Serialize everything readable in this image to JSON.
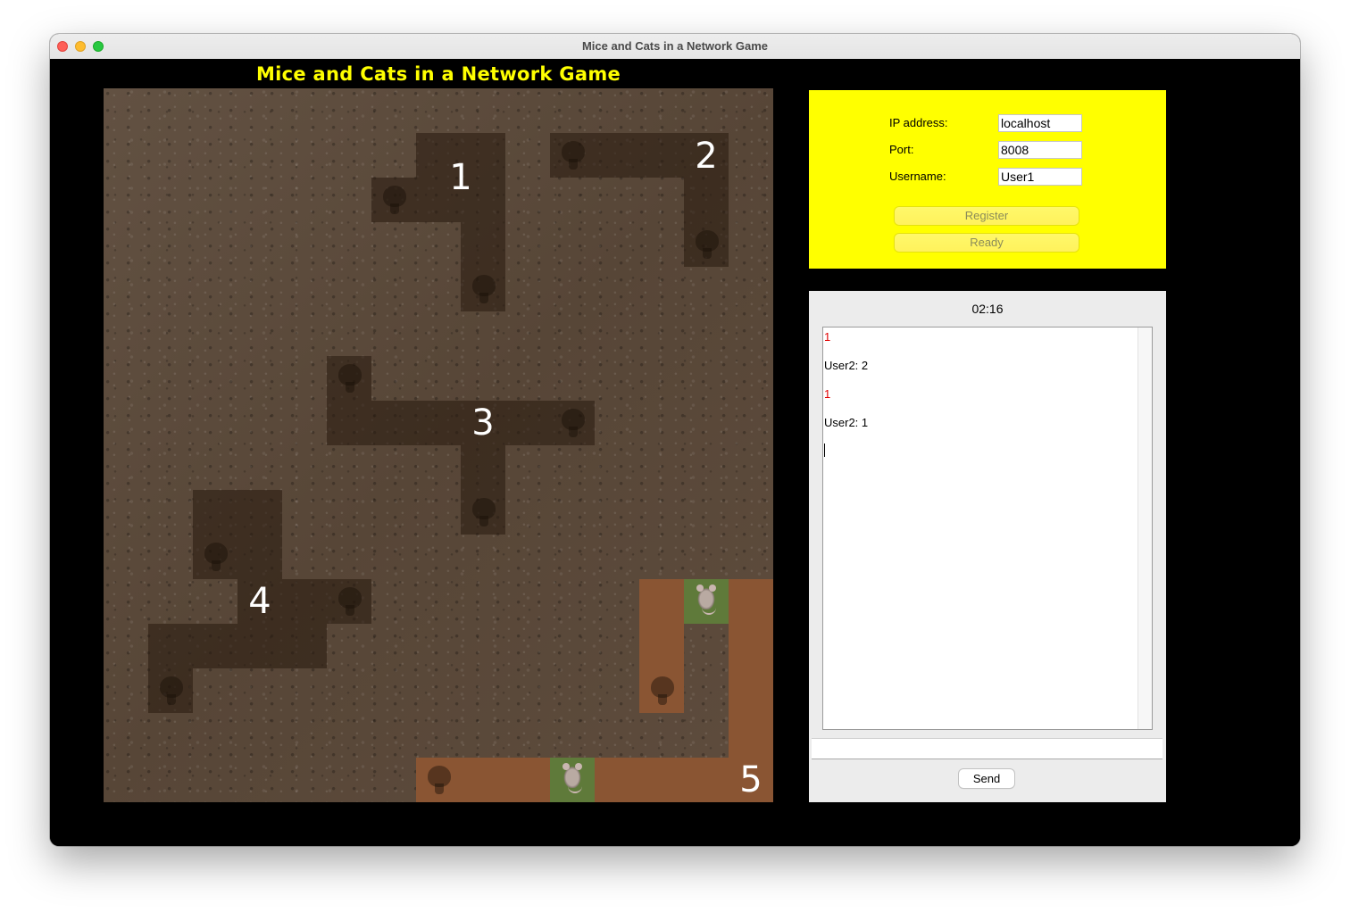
{
  "window": {
    "title": "Mice and Cats in a Network Game"
  },
  "game": {
    "title": "Mice and Cats in a Network Game",
    "hole_numbers": [
      "1",
      "2",
      "3",
      "4",
      "5"
    ]
  },
  "connection": {
    "ip_label": "IP address:",
    "ip_value": "localhost",
    "port_label": "Port:",
    "port_value": "8008",
    "username_label": "Username:",
    "username_value": "User1",
    "register_label": "Register",
    "ready_label": "Ready"
  },
  "chat": {
    "timer": "02:16",
    "messages": [
      {
        "text": "1",
        "color": "#e10000"
      },
      {
        "text": "User2: 2",
        "color": "#000000"
      },
      {
        "text": "1",
        "color": "#e10000"
      },
      {
        "text": "User2: 1",
        "color": "#000000"
      }
    ],
    "input_value": "",
    "send_label": "Send"
  },
  "colors": {
    "title_yellow": "#ffff00",
    "panel_yellow": "#ffff00",
    "window_bg": "#000000",
    "active_path": "#8a5533",
    "tunnel": "#3a2a1c"
  }
}
